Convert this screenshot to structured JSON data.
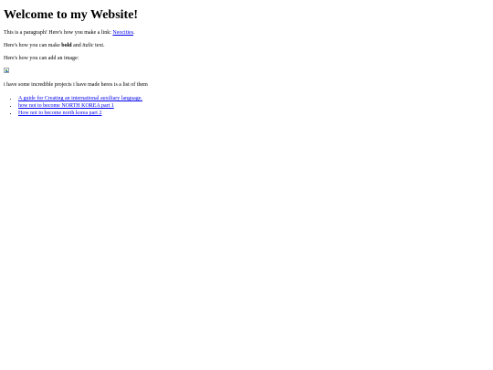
{
  "page": {
    "heading": "Welcome to my Website!",
    "paragraph1": {
      "before": "This is a paragraph! Here's how you make a link: ",
      "link_text": "Neocities",
      "after": "."
    },
    "paragraph2": {
      "before": "Here's how you can make ",
      "bold": "bold",
      "middle": " and ",
      "italic": "italic",
      "after": " text."
    },
    "paragraph3": "Here's how you can add an image:",
    "image": {
      "state": "broken",
      "icon": "broken-image-icon"
    },
    "paragraph4": "i have some incredible projects i have made heres is a list of them",
    "projects": [
      "A guide for Creating an international auxiliary language.",
      "how not to become NORTH KOREA part 1",
      "How not to become north korea part 2"
    ]
  },
  "colors": {
    "link": "#0000ee",
    "text": "#000000",
    "background": "#ffffff"
  }
}
